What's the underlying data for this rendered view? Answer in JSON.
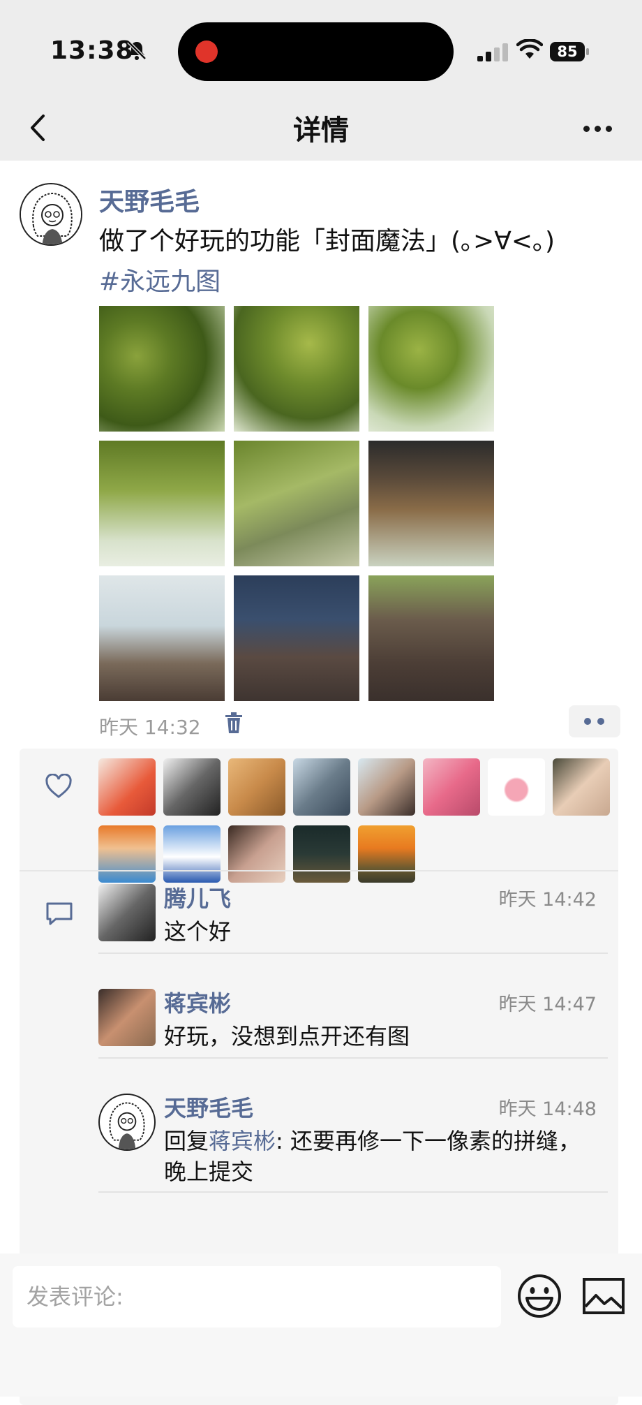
{
  "status_bar": {
    "time": "13:38",
    "battery": "85"
  },
  "nav": {
    "title": "详情"
  },
  "post": {
    "author": "天野毛毛",
    "content": "做了个好玩的功能「封面魔法」(｡>∀<｡)",
    "hashtag": "#永远九图",
    "timestamp": "昨天 14:32"
  },
  "comments": [
    {
      "name": "腾儿飞",
      "time": "昨天 14:42",
      "text": "这个好"
    },
    {
      "name": "蒋宾彬",
      "time": "昨天 14:47",
      "text": "好玩，没想到点开还有图"
    },
    {
      "name": "天野毛毛",
      "time": "昨天 14:48",
      "reply_prefix": "回复",
      "reply_to": "蒋宾彬",
      "text": ": 还要再修一下一像素的拼缝，",
      "text2": "晚上提交"
    }
  ],
  "input": {
    "placeholder": "发表评论:"
  },
  "colors": {
    "link": "#576b95",
    "background": "#ededed"
  }
}
